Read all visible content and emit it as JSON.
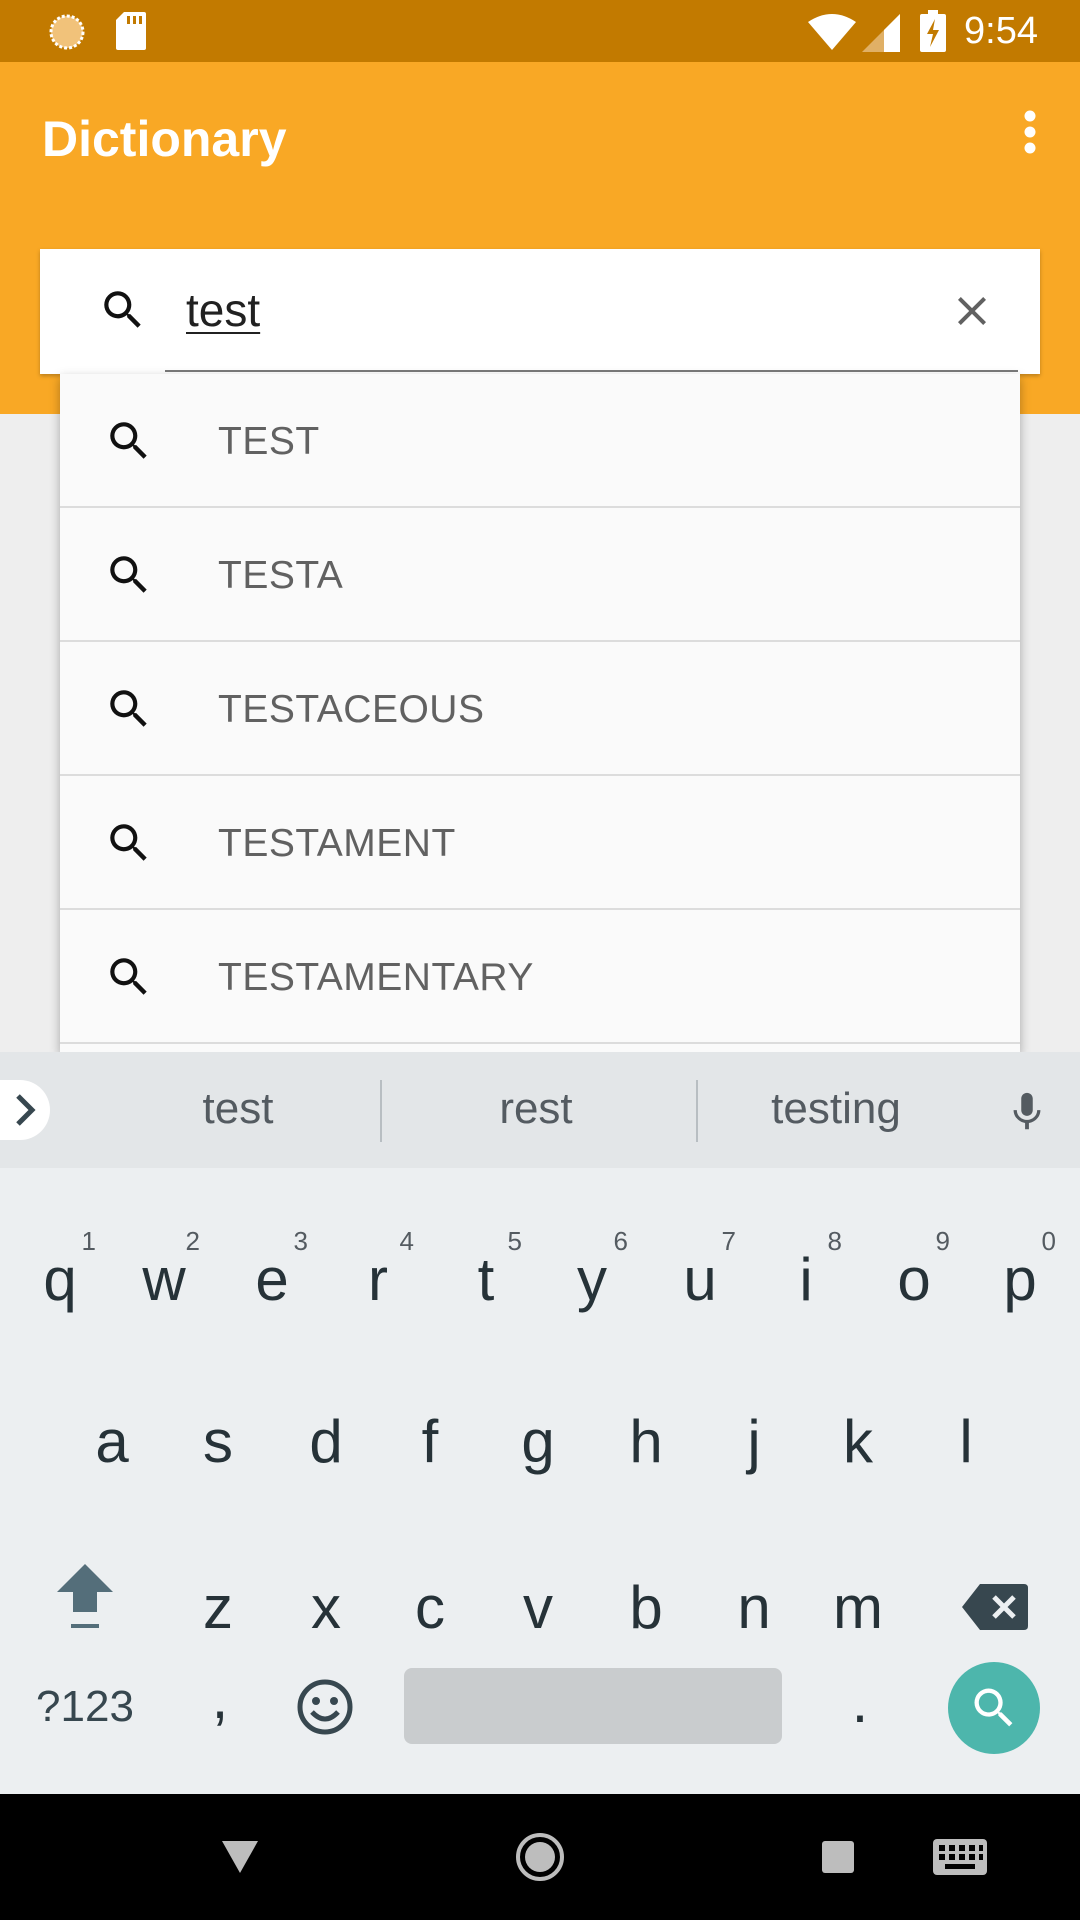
{
  "status_bar": {
    "time": "9:54",
    "icons": [
      "sync-icon",
      "sd-card-icon",
      "wifi-icon",
      "signal-icon",
      "battery-charging-icon"
    ],
    "background": "#c27a00"
  },
  "app_bar": {
    "title": "Dictionary",
    "background": "#f9a825",
    "overflow_icon": "more-vert-icon"
  },
  "search": {
    "query": "test",
    "search_icon": "search-icon",
    "clear_icon": "close-icon"
  },
  "suggestions": [
    {
      "label": "TEST"
    },
    {
      "label": "TESTA"
    },
    {
      "label": "TESTACEOUS"
    },
    {
      "label": "TESTAMENT"
    },
    {
      "label": "TESTAMENTARY"
    }
  ],
  "keyboard": {
    "word_suggestions": [
      "test",
      "rest",
      "testing"
    ],
    "row1": [
      {
        "key": "q",
        "hint": "1"
      },
      {
        "key": "w",
        "hint": "2"
      },
      {
        "key": "e",
        "hint": "3"
      },
      {
        "key": "r",
        "hint": "4"
      },
      {
        "key": "t",
        "hint": "5"
      },
      {
        "key": "y",
        "hint": "6"
      },
      {
        "key": "u",
        "hint": "7"
      },
      {
        "key": "i",
        "hint": "8"
      },
      {
        "key": "o",
        "hint": "9"
      },
      {
        "key": "p",
        "hint": "0"
      }
    ],
    "row2": [
      "a",
      "s",
      "d",
      "f",
      "g",
      "h",
      "j",
      "k",
      "l"
    ],
    "row3": [
      "z",
      "x",
      "c",
      "v",
      "b",
      "n",
      "m"
    ],
    "symbols_label": "?123",
    "comma": ",",
    "period": ".",
    "accent": "#4db6ac"
  },
  "nav_bar": {
    "buttons": [
      "back-icon",
      "home-icon",
      "recents-icon",
      "keyboard-switch-icon"
    ]
  }
}
